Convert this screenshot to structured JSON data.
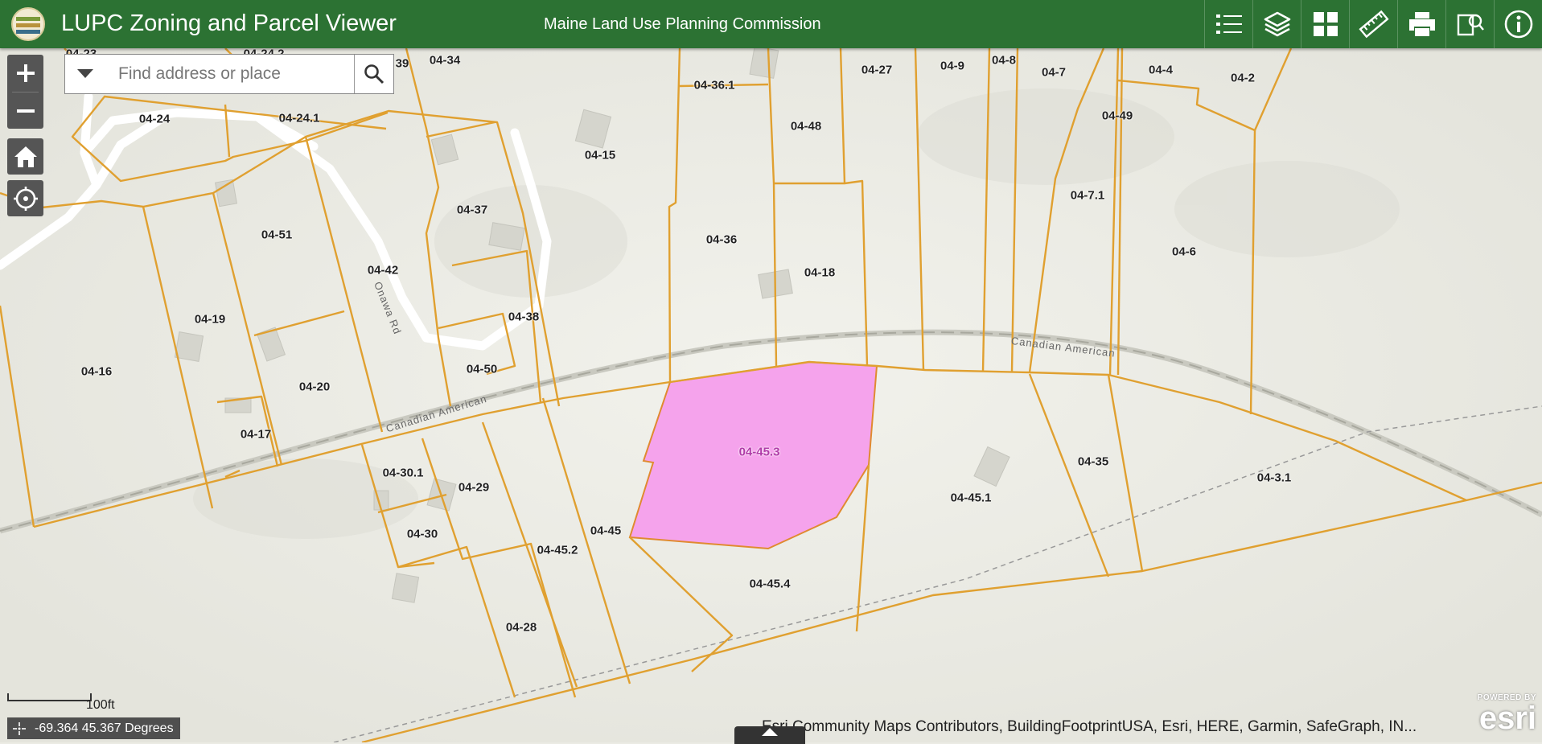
{
  "header": {
    "title": "LUPC Zoning and Parcel Viewer",
    "subtitle": "Maine Land Use Planning Commission",
    "tools": [
      {
        "name": "legend-icon"
      },
      {
        "name": "layers-icon"
      },
      {
        "name": "basemap-gallery-icon"
      },
      {
        "name": "measure-icon"
      },
      {
        "name": "print-icon"
      },
      {
        "name": "query-icon"
      },
      {
        "name": "info-icon"
      }
    ]
  },
  "search": {
    "placeholder": "Find address or place"
  },
  "colors": {
    "header": "#2c7233",
    "parcel_line": "#e0a030",
    "selected_fill": "#f5a3ec",
    "selected_stroke": "#e08a30"
  },
  "map": {
    "selected_parcel": "04-45.3",
    "parcels": [
      "04-23",
      "04-24.2",
      "39",
      "04-34",
      "04-36.1",
      "04-27",
      "04-9",
      "04-8",
      "04-7",
      "04-4",
      "04-2",
      "04-24",
      "04-24.1",
      "04-15",
      "04-48",
      "04-49",
      "04-37",
      "04-7.1",
      "04-51",
      "04-36",
      "04-6",
      "04-42",
      "04-18",
      "04-19",
      "04-38",
      "04-16",
      "04-50",
      "04-20",
      "04-45.3",
      "04-17",
      "04-35",
      "04-30.1",
      "04-29",
      "04-3.1",
      "04-45.1",
      "04-45",
      "04-30",
      "04-45.2",
      "04-45.4",
      "04-28"
    ],
    "roads": [
      "Onawa Rd",
      "Canadian American",
      "Canadian American"
    ]
  },
  "scale": {
    "label": "100ft"
  },
  "coordinates": {
    "text": "-69.364 45.367 Degrees"
  },
  "attribution": {
    "text": "Esri Community Maps Contributors, BuildingFootprintUSA, Esri, HERE, Garmin, SafeGraph, IN..."
  },
  "esri": {
    "powered_by": "POWERED BY",
    "brand": "esri"
  }
}
